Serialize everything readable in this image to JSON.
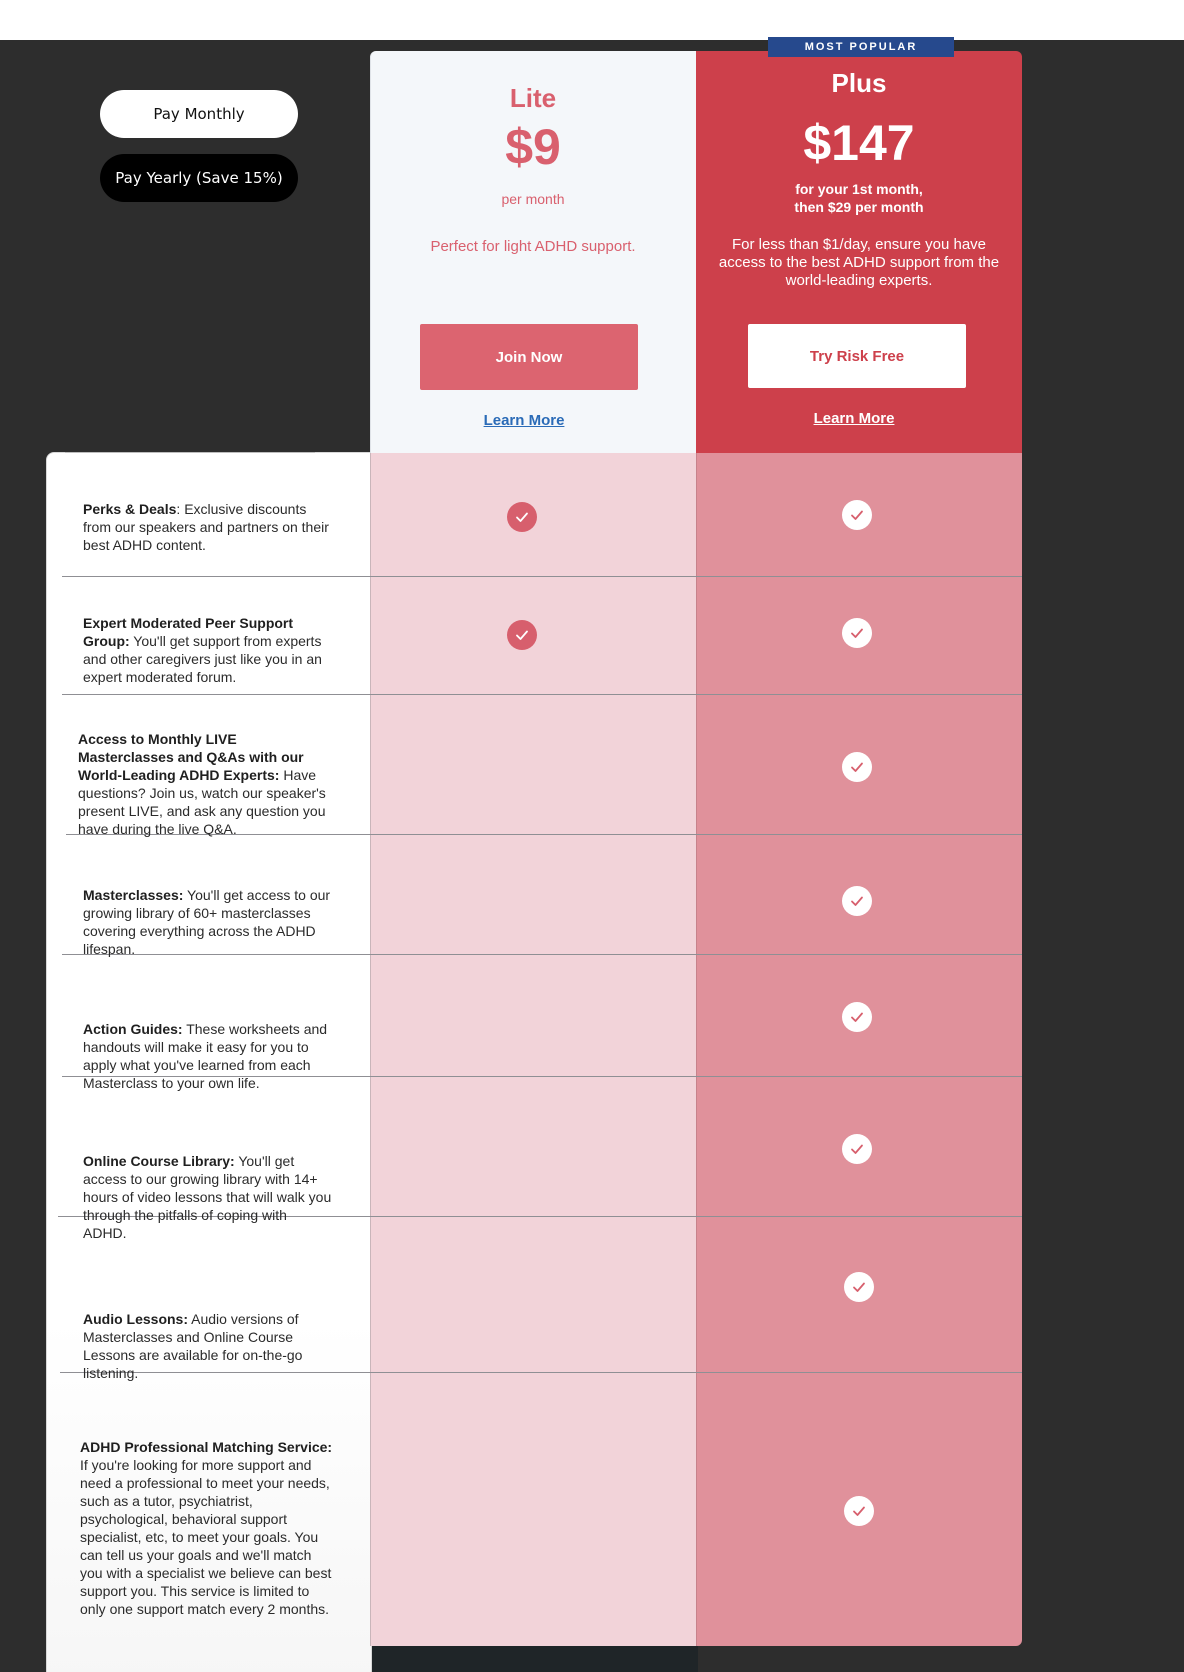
{
  "billing_toggle": {
    "monthly_label": "Pay Monthly",
    "yearly_label": "Pay Yearly (Save 15%)"
  },
  "plans": [
    {
      "name": "Lite",
      "price": "$9",
      "price_note": "per month",
      "description": "Perfect for light ADHD support.",
      "cta_label": "Join Now",
      "learn_more": "Learn More"
    },
    {
      "badge": "MOST POPULAR",
      "name": "Plus",
      "price": "$147",
      "price_note_line1": "for your 1st month,",
      "price_note_line2": "then $29 per month",
      "description": "For less than $1/day, ensure you have access to the best ADHD support from the world-leading experts.",
      "cta_label": "Try Risk Free",
      "learn_more": "Learn More"
    }
  ],
  "features": [
    {
      "title": "Perks & Deals",
      "sep": ": ",
      "text": "Exclusive discounts from our speakers and partners on their best ADHD content.",
      "lite": true,
      "plus": true
    },
    {
      "title": "Expert Moderated Peer Support Group:",
      "sep": " ",
      "text": "You'll get support from experts and other caregivers just like you in an expert moderated forum.",
      "lite": true,
      "plus": true
    },
    {
      "title": "Access to Monthly LIVE Masterclasses and Q&As with our World-Leading ADHD Experts:",
      "sep": " ",
      "text": "Have questions? Join us, watch our speaker's present LIVE, and ask any question you have during the live Q&A.",
      "lite": false,
      "plus": true
    },
    {
      "title": "Masterclasses:",
      "sep": " ",
      "text": "You'll get access to our growing library of 60+ masterclasses covering everything across the ADHD lifespan.",
      "lite": false,
      "plus": true
    },
    {
      "title": "Action Guides:",
      "sep": " ",
      "text": "These worksheets and handouts will make it easy for you to apply what you've learned from each Masterclass to your own life.",
      "lite": false,
      "plus": true
    },
    {
      "title": "Online Course Library:",
      "sep": " ",
      "text": "You'll get access to our growing library with 14+ hours of video lessons that will walk you through the pitfalls of coping with ADHD.",
      "lite": false,
      "plus": true
    },
    {
      "title": "Audio Lessons:",
      "sep": " ",
      "text": "Audio versions of Masterclasses and Online Course Lessons are available for on-the-go listening.",
      "lite": false,
      "plus": true
    },
    {
      "title": "ADHD Professional Matching Service:",
      "sep": " ",
      "text": "If you're looking for more support and need a professional to meet your needs, such as a tutor, psychiatrist, psychological, behavioral support specialist, etc, to meet your goals. You can tell us your goals and we'll match you with a specialist we believe can best support you. This service is limited to only one support match every 2 months.",
      "lite": false,
      "plus": true
    }
  ],
  "colors": {
    "lite_accent": "#d9606e",
    "plus_accent": "#cd404b",
    "badge_bg": "#26498d",
    "link_blue": "#2a6bb7"
  }
}
